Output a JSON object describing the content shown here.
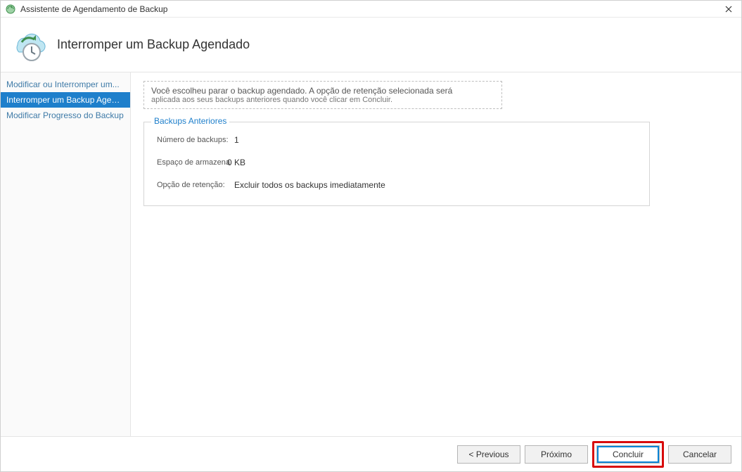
{
  "window": {
    "title": "Assistente de Agendamento de Backup"
  },
  "header": {
    "title": "Interromper um Backup Agendado"
  },
  "sidebar": {
    "items": [
      {
        "label": "Modificar ou Interromper um...",
        "selected": false
      },
      {
        "label": "Interromper um Backup Agendado",
        "selected": true
      },
      {
        "label": "Modificar Progresso do Backup",
        "selected": false
      }
    ]
  },
  "info": {
    "line1": "Você escolheu parar o backup agendado. A opção de retenção selecionada será",
    "line2": "aplicada aos seus backups anteriores quando você clicar em Concluir."
  },
  "fieldset": {
    "legend": "Backups Anteriores",
    "rows": {
      "count_label": "Número de backups:",
      "count_value": "1",
      "storage_label": "Espaço de armazenamento usado:",
      "storage_value": "0 KB",
      "retention_label": "Opção de retenção:",
      "retention_value": "Excluir todos os backups imediatamente"
    }
  },
  "footer": {
    "previous": "< Previous",
    "next": "Próximo",
    "finish": "Concluir",
    "cancel": "Cancelar"
  }
}
